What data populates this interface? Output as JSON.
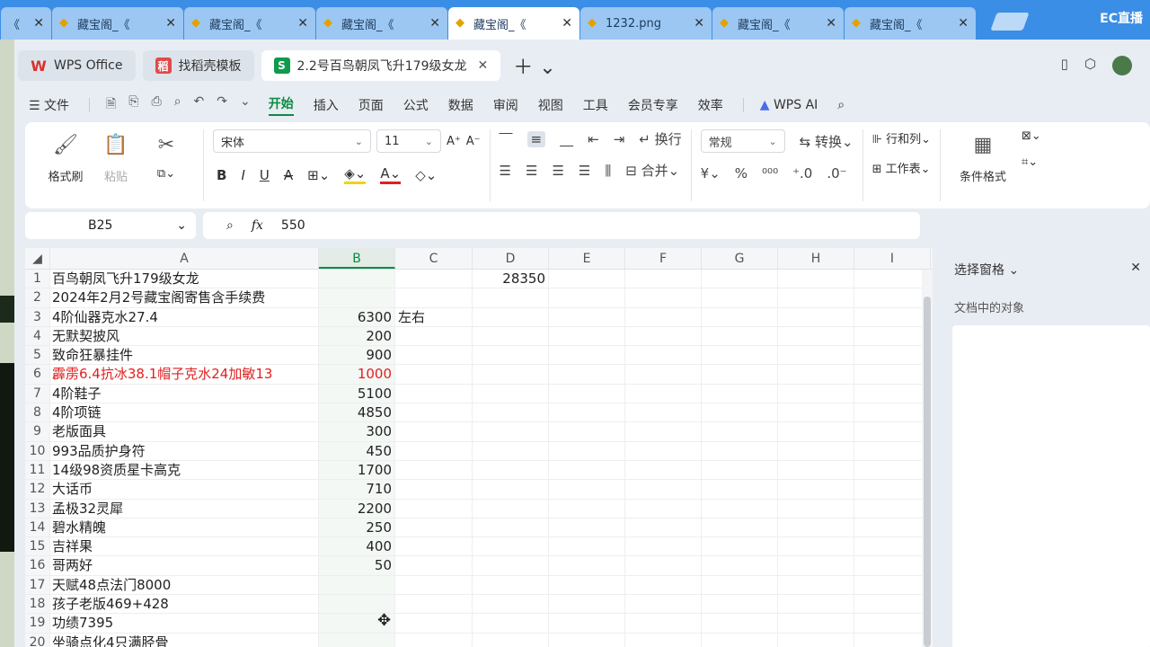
{
  "browser": {
    "tabs": [
      {
        "label": "《"
      },
      {
        "label": "藏宝阁_《"
      },
      {
        "label": "藏宝阁_《"
      },
      {
        "label": "藏宝阁_《"
      },
      {
        "label": "藏宝阁_《"
      },
      {
        "label": "1232.png"
      },
      {
        "label": "藏宝阁_《"
      },
      {
        "label": "藏宝阁_《"
      }
    ],
    "active_index": 4,
    "brand": "EC直播"
  },
  "app_tabs": [
    {
      "label": "WPS Office",
      "icon": "W"
    },
    {
      "label": "找稻壳模板",
      "icon": "稻"
    },
    {
      "label": "2.2号百鸟朝凤飞升179级女龙",
      "icon": "S"
    }
  ],
  "menu": {
    "file": "文件",
    "items": [
      "开始",
      "插入",
      "页面",
      "公式",
      "数据",
      "审阅",
      "视图",
      "工具",
      "会员专享",
      "效率"
    ],
    "active": "开始",
    "ai": "WPS AI"
  },
  "ribbon": {
    "format_painter": "格式刷",
    "paste": "粘贴",
    "font_name": "宋体",
    "font_size": "11",
    "wrap": "换行",
    "merge": "合并",
    "number_format": "常规",
    "convert": "转换",
    "rows_cols": "行和列",
    "sheet": "工作表",
    "cond_format": "条件格式"
  },
  "formula_bar": {
    "cell_ref": "B25",
    "value": "550"
  },
  "columns": [
    "A",
    "B",
    "C",
    "D",
    "E",
    "F",
    "G",
    "H",
    "I"
  ],
  "selected_column": "B",
  "rows": [
    {
      "n": "1",
      "a": "百鸟朝凤飞升179级女龙",
      "b": "",
      "c": "",
      "d": "28350"
    },
    {
      "n": "2",
      "a": "2024年2月2号藏宝阁寄售含手续费",
      "b": "",
      "c": "",
      "d": ""
    },
    {
      "n": "3",
      "a": "4阶仙器克水27.4",
      "b": "6300",
      "c": "左右",
      "d": ""
    },
    {
      "n": "4",
      "a": "无默契披风",
      "b": "200",
      "c": "",
      "d": ""
    },
    {
      "n": "5",
      "a": "致命狂暴挂件",
      "b": "900",
      "c": "",
      "d": ""
    },
    {
      "n": "6",
      "a": "霹雳6.4抗冰38.1帽子克水24加敏13",
      "b": "1000",
      "c": "",
      "d": "",
      "red": true
    },
    {
      "n": "7",
      "a": "4阶鞋子",
      "b": "5100",
      "c": "",
      "d": ""
    },
    {
      "n": "8",
      "a": "4阶项链",
      "b": "4850",
      "c": "",
      "d": ""
    },
    {
      "n": "9",
      "a": "老版面具",
      "b": "300",
      "c": "",
      "d": ""
    },
    {
      "n": "10",
      "a": "993品质护身符",
      "b": "450",
      "c": "",
      "d": ""
    },
    {
      "n": "11",
      "a": "14级98资质星卡高克",
      "b": "1700",
      "c": "",
      "d": ""
    },
    {
      "n": "12",
      "a": "大话币",
      "b": "710",
      "c": "",
      "d": ""
    },
    {
      "n": "13",
      "a": "孟极32灵犀",
      "b": "2200",
      "c": "",
      "d": ""
    },
    {
      "n": "14",
      "a": "碧水精魄",
      "b": "250",
      "c": "",
      "d": ""
    },
    {
      "n": "15",
      "a": "吉祥果",
      "b": "400",
      "c": "",
      "d": ""
    },
    {
      "n": "16",
      "a": "哥两好",
      "b": "50",
      "c": "",
      "d": ""
    },
    {
      "n": "17",
      "a": "天赋48点法门8000",
      "b": "",
      "c": "",
      "d": ""
    },
    {
      "n": "18",
      "a": "孩子老版469+428",
      "b": "",
      "c": "",
      "d": ""
    },
    {
      "n": "19",
      "a": "功绩7395",
      "b": "",
      "c": "",
      "d": ""
    },
    {
      "n": "20",
      "a": "坐骑点化4只满胫骨",
      "b": "",
      "c": "",
      "d": ""
    }
  ],
  "pane": {
    "title": "选择窗格",
    "subtitle": "文档中的对象"
  }
}
